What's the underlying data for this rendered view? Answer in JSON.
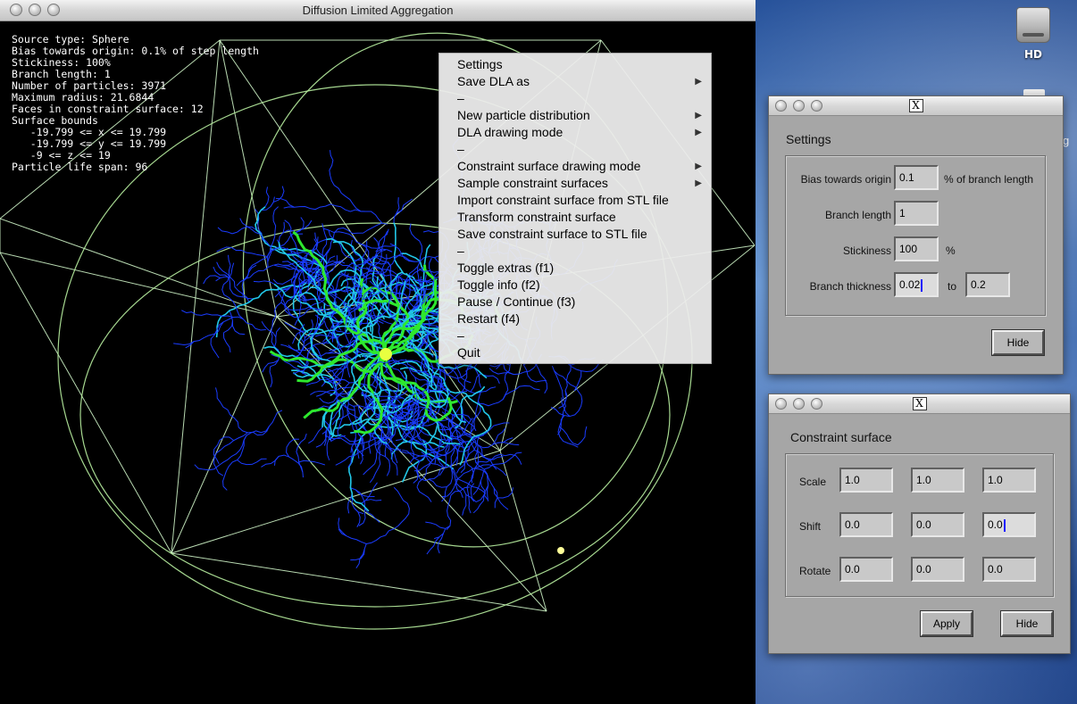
{
  "desktop": {
    "hd_label": "HD",
    "peek_text": "g"
  },
  "main_window": {
    "title": "Diffusion Limited Aggregation",
    "info_lines": [
      "Source type: Sphere",
      "Bias towards origin: 0.1% of step length",
      "Stickiness: 100%",
      "Branch length: 1",
      "Number of particles: 3971",
      "Maximum radius: 21.6844",
      "Faces in constraint surface: 12",
      "Surface bounds",
      "   -19.799 <= x <= 19.799",
      "   -19.799 <= y <= 19.799",
      "   -9 <= z <= 19",
      "Particle life span: 96"
    ]
  },
  "context_menu": {
    "items": [
      {
        "label": "Settings",
        "submenu": false
      },
      {
        "label": "Save DLA as",
        "submenu": true
      },
      {
        "label": "–",
        "separator": true
      },
      {
        "label": "New particle distribution",
        "submenu": true
      },
      {
        "label": "DLA drawing mode",
        "submenu": true
      },
      {
        "label": "–",
        "separator": true
      },
      {
        "label": "Constraint surface drawing mode",
        "submenu": true
      },
      {
        "label": "Sample constraint surfaces",
        "submenu": true
      },
      {
        "label": "Import constraint surface from STL file",
        "submenu": false
      },
      {
        "label": "Transform constraint surface",
        "submenu": false
      },
      {
        "label": "Save constraint surface to STL file",
        "submenu": false
      },
      {
        "label": "–",
        "separator": true
      },
      {
        "label": "Toggle extras (f1)",
        "submenu": false
      },
      {
        "label": "Toggle info (f2)",
        "submenu": false
      },
      {
        "label": "Pause / Continue (f3)",
        "submenu": false
      },
      {
        "label": "Restart (f4)",
        "submenu": false
      },
      {
        "label": "–",
        "separator": true
      },
      {
        "label": "Quit",
        "submenu": false
      }
    ],
    "arrow_glyph": "▶"
  },
  "settings_dialog": {
    "title_glyph": "X",
    "heading": "Settings",
    "bias_label": "Bias towards origin",
    "bias_value": "0.1",
    "bias_unit": "% of branch length",
    "branch_length_label": "Branch length",
    "branch_length_value": "1",
    "stickiness_label": "Stickiness",
    "stickiness_value": "100",
    "stickiness_unit": "%",
    "thickness_label": "Branch thickness",
    "thickness_min": "0.02",
    "thickness_to": "to",
    "thickness_max": "0.2",
    "hide_label": "Hide"
  },
  "constraint_dialog": {
    "title_glyph": "X",
    "heading": "Constraint surface",
    "rows": [
      {
        "label": "Scale",
        "values": [
          "1.0",
          "1.0",
          "1.0"
        ]
      },
      {
        "label": "Shift",
        "values": [
          "0.0",
          "0.0",
          "0.0"
        ]
      },
      {
        "label": "Rotate",
        "values": [
          "0.0",
          "0.0",
          "0.0"
        ]
      }
    ],
    "apply_label": "Apply",
    "hide_label": "Hide"
  },
  "colors": {
    "wire": "#d8ffd0",
    "ellipse": "#b8f0a0",
    "branch_blue": "#1a3cff",
    "branch_cyan": "#22c8e8",
    "branch_green": "#2ee82e",
    "branch_yellow": "#e8ff40"
  }
}
